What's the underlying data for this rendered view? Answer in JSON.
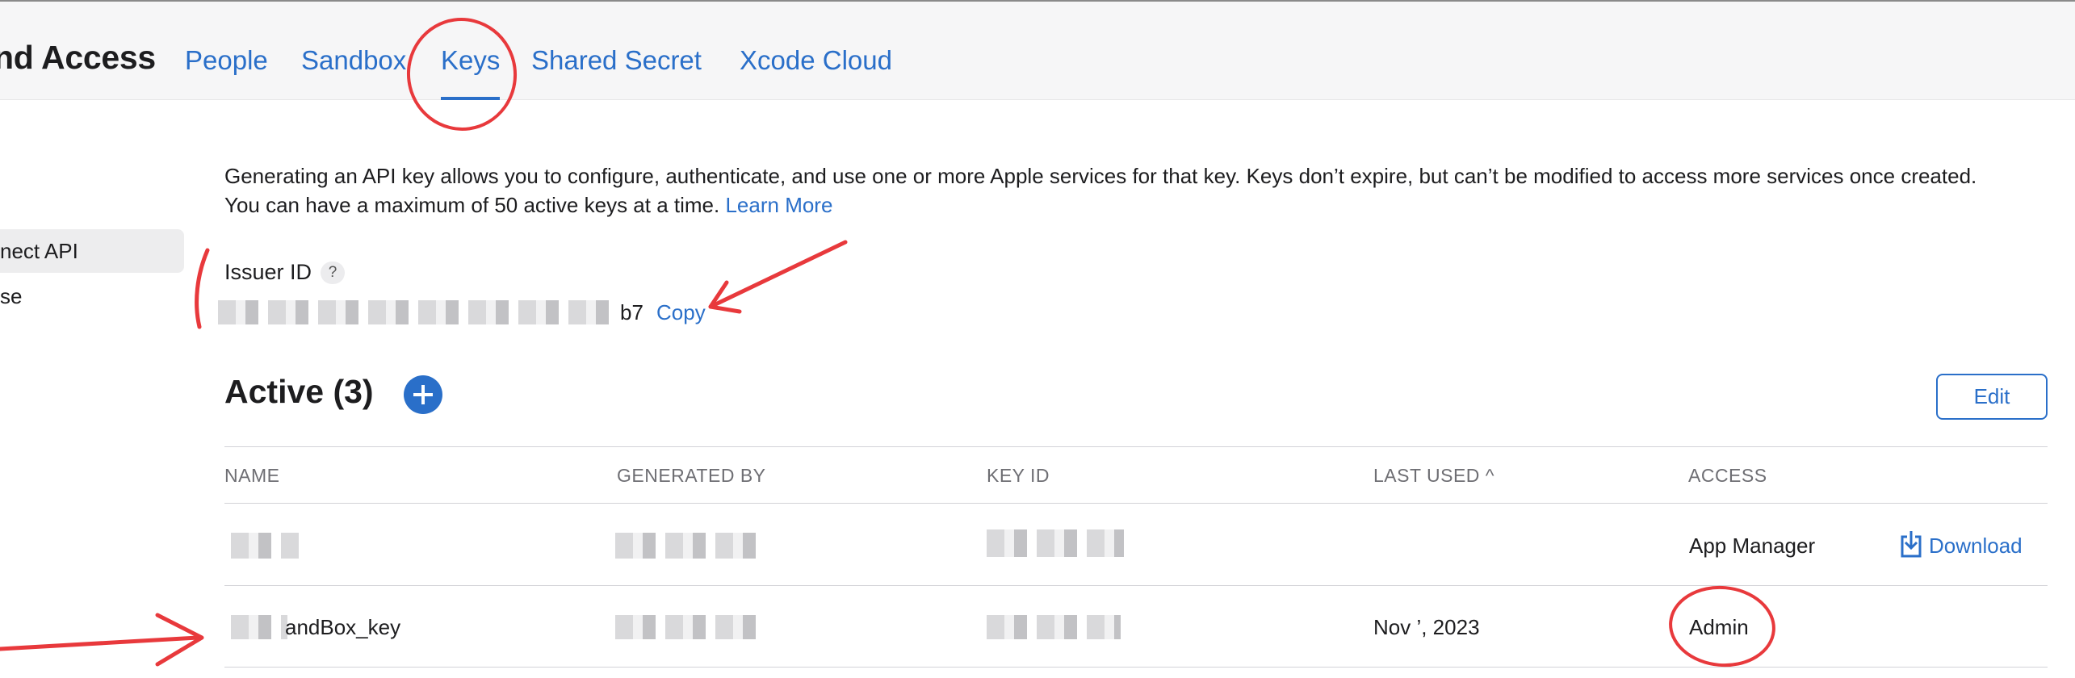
{
  "header": {
    "app_title": "nd Access",
    "tabs": [
      {
        "label": "People"
      },
      {
        "label": "Sandbox"
      },
      {
        "label": "Keys",
        "active": true
      },
      {
        "label": "Shared Secret"
      },
      {
        "label": "Xcode Cloud"
      }
    ]
  },
  "sidebar": {
    "items": [
      {
        "label": "nect API",
        "selected": true
      },
      {
        "label": "se",
        "selected": false
      }
    ]
  },
  "intro": {
    "text": "Generating an API key allows you to configure, authenticate, and use one or more Apple services for that key. Keys don’t expire, but can’t be modified to access more services once created. You can have a maximum of 50 active keys at a time.",
    "learn_more": "Learn More"
  },
  "issuer": {
    "label": "Issuer ID",
    "help": "?",
    "id_suffix": "b7",
    "copy_label": "Copy"
  },
  "keys": {
    "title": "Active (3)",
    "edit_label": "Edit",
    "columns": [
      "NAME",
      "GENERATED BY",
      "KEY ID",
      "LAST USED ^",
      "ACCESS"
    ],
    "rows": [
      {
        "name": "",
        "generated_by": "",
        "key_id": "",
        "last_used": "",
        "access": "App Manager",
        "download": "Download"
      },
      {
        "name": "andBox_key",
        "generated_by": "",
        "key_id": "",
        "last_used": "Nov ’, 2023",
        "access": "Admin"
      }
    ]
  },
  "colors": {
    "accent": "#2a6fc9",
    "annotation": "#e8393c"
  },
  "icons": [
    "help-icon",
    "add-icon",
    "download-icon",
    "sort-ascending-icon"
  ]
}
